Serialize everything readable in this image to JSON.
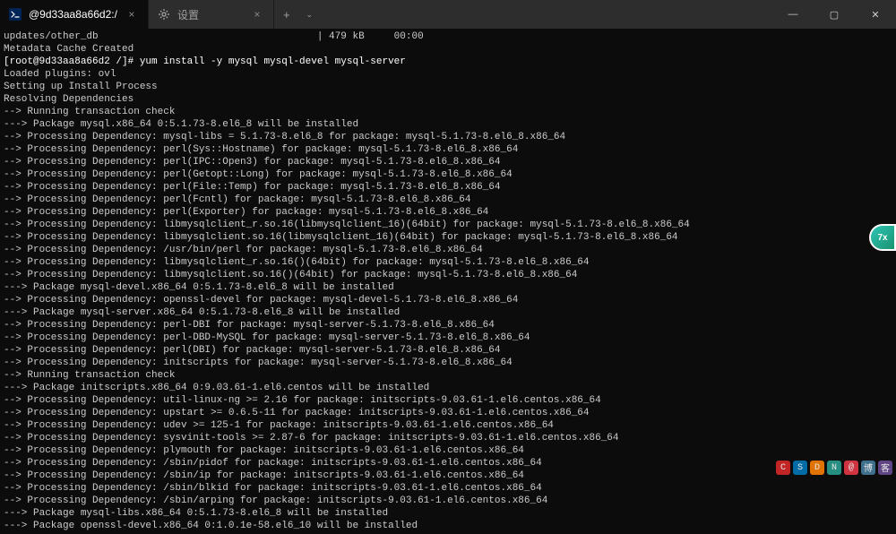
{
  "titlebar": {
    "tabs": [
      {
        "icon": "powershell-icon",
        "title": "@9d33aa8a66d2:/",
        "active": true
      },
      {
        "icon": "settings-icon",
        "title": "设置",
        "active": false
      }
    ],
    "new_tab": "+",
    "dropdown": "⌄",
    "controls": {
      "min": "—",
      "max": "▢",
      "close": "✕"
    }
  },
  "terminal": {
    "lines": [
      "updates/other_db                                     | 479 kB     00:00",
      "Metadata Cache Created",
      "[root@9d33aa8a66d2 /]# yum install -y mysql mysql-devel mysql-server",
      "Loaded plugins: ovl",
      "Setting up Install Process",
      "Resolving Dependencies",
      "--> Running transaction check",
      "---> Package mysql.x86_64 0:5.1.73-8.el6_8 will be installed",
      "--> Processing Dependency: mysql-libs = 5.1.73-8.el6_8 for package: mysql-5.1.73-8.el6_8.x86_64",
      "--> Processing Dependency: perl(Sys::Hostname) for package: mysql-5.1.73-8.el6_8.x86_64",
      "--> Processing Dependency: perl(IPC::Open3) for package: mysql-5.1.73-8.el6_8.x86_64",
      "--> Processing Dependency: perl(Getopt::Long) for package: mysql-5.1.73-8.el6_8.x86_64",
      "--> Processing Dependency: perl(File::Temp) for package: mysql-5.1.73-8.el6_8.x86_64",
      "--> Processing Dependency: perl(Fcntl) for package: mysql-5.1.73-8.el6_8.x86_64",
      "--> Processing Dependency: perl(Exporter) for package: mysql-5.1.73-8.el6_8.x86_64",
      "--> Processing Dependency: libmysqlclient_r.so.16(libmysqlclient_16)(64bit) for package: mysql-5.1.73-8.el6_8.x86_64",
      "--> Processing Dependency: libmysqlclient.so.16(libmysqlclient_16)(64bit) for package: mysql-5.1.73-8.el6_8.x86_64",
      "--> Processing Dependency: /usr/bin/perl for package: mysql-5.1.73-8.el6_8.x86_64",
      "--> Processing Dependency: libmysqlclient_r.so.16()(64bit) for package: mysql-5.1.73-8.el6_8.x86_64",
      "--> Processing Dependency: libmysqlclient.so.16()(64bit) for package: mysql-5.1.73-8.el6_8.x86_64",
      "---> Package mysql-devel.x86_64 0:5.1.73-8.el6_8 will be installed",
      "--> Processing Dependency: openssl-devel for package: mysql-devel-5.1.73-8.el6_8.x86_64",
      "---> Package mysql-server.x86_64 0:5.1.73-8.el6_8 will be installed",
      "--> Processing Dependency: perl-DBI for package: mysql-server-5.1.73-8.el6_8.x86_64",
      "--> Processing Dependency: perl-DBD-MySQL for package: mysql-server-5.1.73-8.el6_8.x86_64",
      "--> Processing Dependency: perl(DBI) for package: mysql-server-5.1.73-8.el6_8.x86_64",
      "--> Processing Dependency: initscripts for package: mysql-server-5.1.73-8.el6_8.x86_64",
      "--> Running transaction check",
      "---> Package initscripts.x86_64 0:9.03.61-1.el6.centos will be installed",
      "--> Processing Dependency: util-linux-ng >= 2.16 for package: initscripts-9.03.61-1.el6.centos.x86_64",
      "--> Processing Dependency: upstart >= 0.6.5-11 for package: initscripts-9.03.61-1.el6.centos.x86_64",
      "--> Processing Dependency: udev >= 125-1 for package: initscripts-9.03.61-1.el6.centos.x86_64",
      "--> Processing Dependency: sysvinit-tools >= 2.87-6 for package: initscripts-9.03.61-1.el6.centos.x86_64",
      "--> Processing Dependency: plymouth for package: initscripts-9.03.61-1.el6.centos.x86_64",
      "--> Processing Dependency: /sbin/pidof for package: initscripts-9.03.61-1.el6.centos.x86_64",
      "--> Processing Dependency: /sbin/ip for package: initscripts-9.03.61-1.el6.centos.x86_64",
      "--> Processing Dependency: /sbin/blkid for package: initscripts-9.03.61-1.el6.centos.x86_64",
      "--> Processing Dependency: /sbin/arping for package: initscripts-9.03.61-1.el6.centos.x86_64",
      "---> Package mysql-libs.x86_64 0:5.1.73-8.el6_8 will be installed",
      "---> Package openssl-devel.x86_64 0:1.0.1e-58.el6_10 will be installed"
    ]
  },
  "floating_badge": "7x",
  "watermark": {
    "colors": [
      "#d62828",
      "#0077b6",
      "#f77f00",
      "#2a9d8f",
      "#e63946",
      "#457b9d",
      "#6a4c93"
    ],
    "glyphs": [
      "C",
      "S",
      "D",
      "N",
      "@",
      "博",
      "客"
    ]
  }
}
